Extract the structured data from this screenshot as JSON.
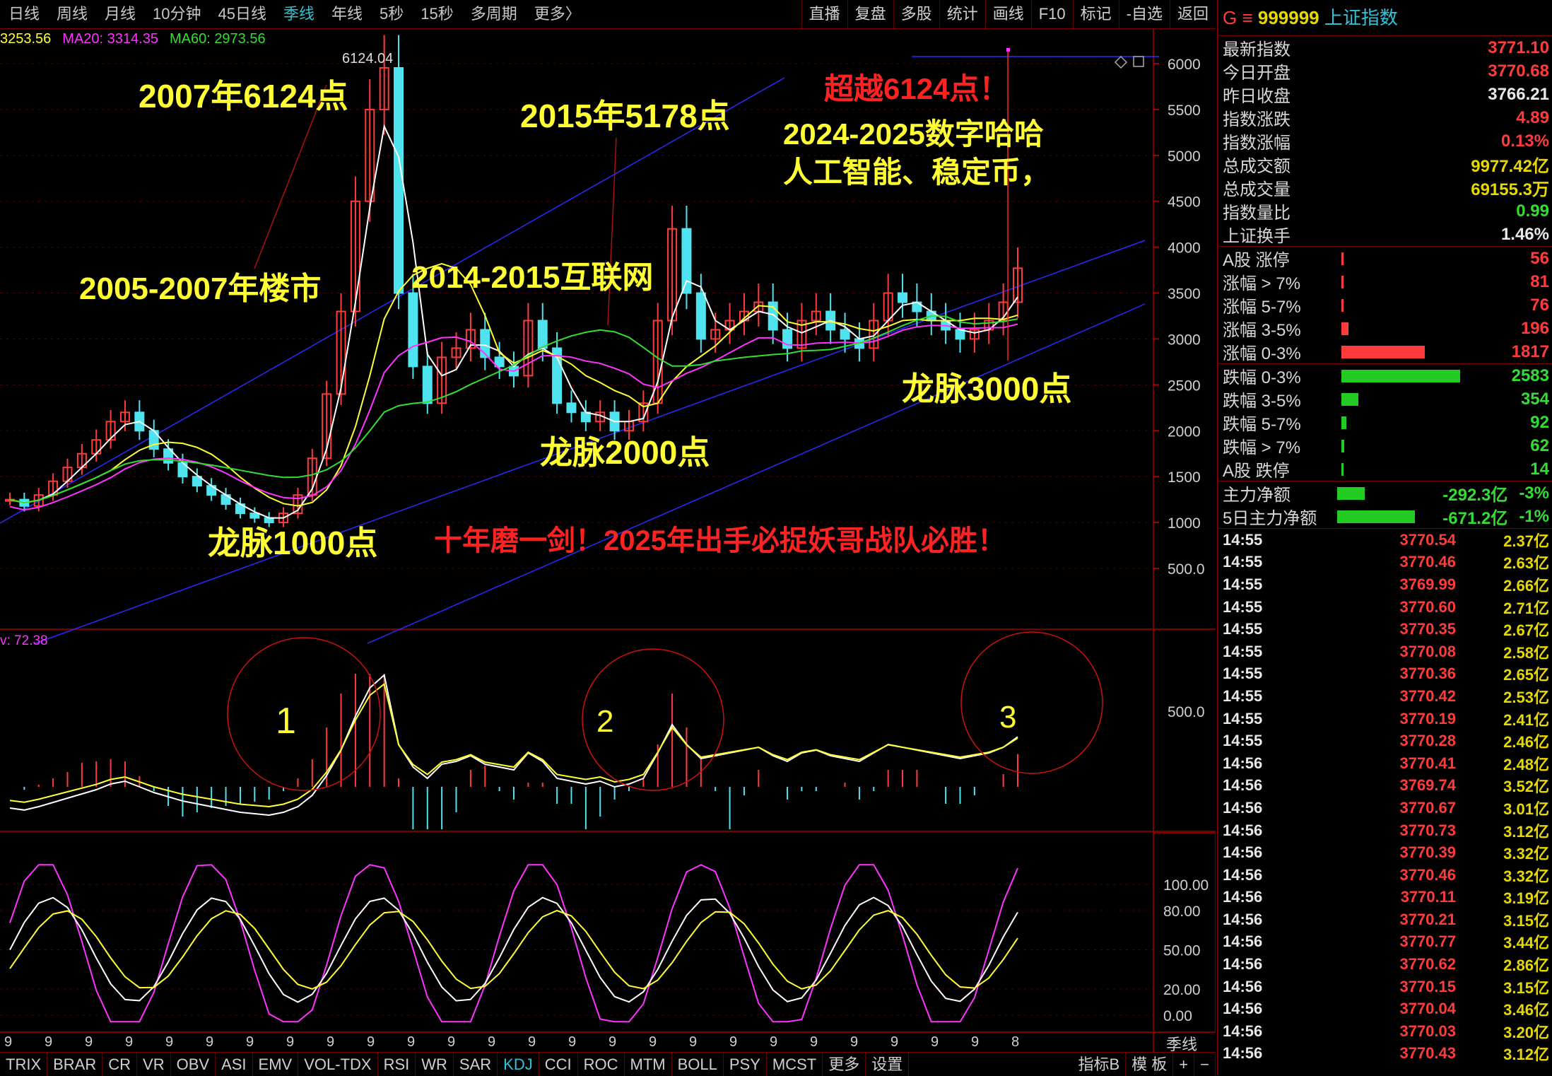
{
  "toolbar": {
    "periods": [
      "日线",
      "周线",
      "月线",
      "10分钟",
      "45日线",
      "季线",
      "年线",
      "5秒",
      "15秒",
      "多周期",
      "更多〉"
    ],
    "active_period": "季线",
    "tools": [
      "直播",
      "复盘",
      "多股",
      "统计",
      "画线",
      "F10",
      "标记",
      "-自选",
      "返回"
    ]
  },
  "ma_legend": [
    {
      "text": "3253.56",
      "color": "#ffff33"
    },
    {
      "text": "MA20: 3314.35",
      "color": "#ff33ff"
    },
    {
      "text": "MA60: 2973.56",
      "color": "#33dd33"
    }
  ],
  "indicator_value": "v: 72.38",
  "peak_label": "6124.04",
  "annotations": {
    "y2007": "2007年6124点",
    "y2015": "2015年5178点",
    "surpass": "超越6124点！",
    "y2024": "2024-2025数字哈哈",
    "ai": "人工智能、稳定币，",
    "housing": "2005-2007年楼市",
    "internet": "2014-2015互联网",
    "lm3000": "龙脉3000点",
    "lm2000": "龙脉2000点",
    "lm1000": "龙脉1000点",
    "slogan": "十年磨一剑！2025年出手必捉妖哥战队必胜！",
    "c1": "1",
    "c2": "2",
    "c3": "3"
  },
  "price_axis": [
    "6000",
    "5500",
    "5000",
    "4500",
    "4000",
    "3500",
    "3000",
    "2500",
    "2000",
    "1500",
    "1000",
    "500.0"
  ],
  "macd_axis": [
    "500.0"
  ],
  "kdj_axis": [
    "100.00",
    "80.00",
    "50.00",
    "20.00",
    "0.00"
  ],
  "x_axis_label": "季线",
  "x_ticks": [
    "9",
    "9",
    "9",
    "9",
    "9",
    "9",
    "9",
    "9",
    "9",
    "9",
    "9",
    "9",
    "9",
    "9",
    "9",
    "9",
    "9",
    "9",
    "9",
    "9",
    "9",
    "9",
    "9",
    "9",
    "9",
    "8"
  ],
  "indicator_tabs": [
    "TRIX",
    "BRAR",
    "CR",
    "VR",
    "OBV",
    "ASI",
    "EMV",
    "VOL-TDX",
    "RSI",
    "WR",
    "SAR",
    "KDJ",
    "CCI",
    "ROC",
    "MTM",
    "BOLL",
    "PSY",
    "MCST",
    "更多",
    "设置"
  ],
  "active_indicator": "KDJ",
  "bottom_right": [
    "指标B",
    "模 板",
    "+",
    "−"
  ],
  "panel": {
    "code_prefix": "G ≡",
    "code": "999999",
    "name": "上证指数",
    "quote": [
      {
        "label": "最新指数",
        "value": "3771.10",
        "color": "#ff3b3b"
      },
      {
        "label": "今日开盘",
        "value": "3770.68",
        "color": "#ff3b3b"
      },
      {
        "label": "昨日收盘",
        "value": "3766.21",
        "color": "#e8e8e8"
      },
      {
        "label": "指数涨跌",
        "value": "4.89",
        "color": "#ff3b3b"
      },
      {
        "label": "指数涨幅",
        "value": "0.13%",
        "color": "#ff3b3b"
      },
      {
        "label": "总成交额",
        "value": "9977.42亿",
        "color": "#e6d800"
      },
      {
        "label": "总成交量",
        "value": "69155.3万",
        "color": "#e6d800"
      },
      {
        "label": "指数量比",
        "value": "0.99",
        "color": "#33dd33"
      },
      {
        "label": "上证换手",
        "value": "1.46%",
        "color": "#e8e8e8"
      }
    ],
    "up_dist": [
      {
        "label": "A股 涨停",
        "value": "56",
        "frac": 0.02
      },
      {
        "label": "涨幅 > 7%",
        "value": "81",
        "frac": 0.02
      },
      {
        "label": "涨幅 5-7%",
        "value": "76",
        "frac": 0.02
      },
      {
        "label": "涨幅 3-5%",
        "value": "196",
        "frac": 0.06
      },
      {
        "label": "涨幅 0-3%",
        "value": "1817",
        "frac": 0.7
      }
    ],
    "down_dist": [
      {
        "label": "跌幅 0-3%",
        "value": "2583",
        "frac": 1.0
      },
      {
        "label": "跌幅 3-5%",
        "value": "354",
        "frac": 0.14
      },
      {
        "label": "跌幅 5-7%",
        "value": "92",
        "frac": 0.04
      },
      {
        "label": "跌幅 > 7%",
        "value": "62",
        "frac": 0.025
      },
      {
        "label": "A股 跌停",
        "value": "14",
        "frac": 0.01
      }
    ],
    "flow": [
      {
        "label": "主力净额",
        "amount": "-292.3亿",
        "pct": "-3%",
        "frac": 0.35
      },
      {
        "label": "5日主力净额",
        "amount": "-671.2亿",
        "pct": "-1%",
        "frac": 1.0
      }
    ],
    "ticks": [
      {
        "t": "14:55",
        "p": "3770.54",
        "v": "2.37亿"
      },
      {
        "t": "14:55",
        "p": "3770.46",
        "v": "2.63亿"
      },
      {
        "t": "14:55",
        "p": "3769.99",
        "v": "2.66亿"
      },
      {
        "t": "14:55",
        "p": "3770.60",
        "v": "2.71亿"
      },
      {
        "t": "14:55",
        "p": "3770.35",
        "v": "2.67亿"
      },
      {
        "t": "14:55",
        "p": "3770.08",
        "v": "2.58亿"
      },
      {
        "t": "14:55",
        "p": "3770.36",
        "v": "2.65亿"
      },
      {
        "t": "14:55",
        "p": "3770.42",
        "v": "2.53亿"
      },
      {
        "t": "14:55",
        "p": "3770.19",
        "v": "2.41亿"
      },
      {
        "t": "14:55",
        "p": "3770.28",
        "v": "2.46亿"
      },
      {
        "t": "14:56",
        "p": "3770.41",
        "v": "2.48亿"
      },
      {
        "t": "14:56",
        "p": "3769.74",
        "v": "3.52亿"
      },
      {
        "t": "14:56",
        "p": "3770.67",
        "v": "3.01亿"
      },
      {
        "t": "14:56",
        "p": "3770.73",
        "v": "3.12亿"
      },
      {
        "t": "14:56",
        "p": "3770.39",
        "v": "3.32亿"
      },
      {
        "t": "14:56",
        "p": "3770.46",
        "v": "3.32亿"
      },
      {
        "t": "14:56",
        "p": "3770.11",
        "v": "3.19亿"
      },
      {
        "t": "14:56",
        "p": "3770.21",
        "v": "3.15亿"
      },
      {
        "t": "14:56",
        "p": "3770.77",
        "v": "3.44亿"
      },
      {
        "t": "14:56",
        "p": "3770.62",
        "v": "2.86亿"
      },
      {
        "t": "14:56",
        "p": "3770.15",
        "v": "3.15亿"
      },
      {
        "t": "14:56",
        "p": "3770.04",
        "v": "3.46亿"
      },
      {
        "t": "14:56",
        "p": "3770.03",
        "v": "3.20亿"
      },
      {
        "t": "14:56",
        "p": "3770.43",
        "v": "3.12亿"
      }
    ]
  },
  "chart_data": {
    "type": "line",
    "title": "",
    "series": [
      {
        "name": "MA20",
        "values": []
      },
      {
        "name": "MA60",
        "values": []
      }
    ],
    "price_close_approx": [
      1250,
      1180,
      1300,
      1450,
      1600,
      1750,
      1900,
      2100,
      2200,
      2000,
      1800,
      1650,
      1500,
      1400,
      1300,
      1200,
      1100,
      1050,
      1000,
      1100,
      1300,
      1700,
      2400,
      3300,
      4500,
      5500,
      5954,
      3500,
      2700,
      2300,
      2800,
      2900,
      3100,
      2800,
      2700,
      2600,
      3200,
      2900,
      2300,
      2200,
      2100,
      2200,
      2000,
      2100,
      2300,
      3200,
      4200,
      3500,
      3000,
      3100,
      3200,
      3300,
      3400,
      3100,
      2900,
      3200,
      3300,
      3100,
      3000,
      2900,
      3200,
      3500,
      3400,
      3300,
      3200,
      3100,
      3000,
      3100,
      3200,
      3400,
      3771
    ],
    "ylim": [
      0,
      6500
    ]
  }
}
